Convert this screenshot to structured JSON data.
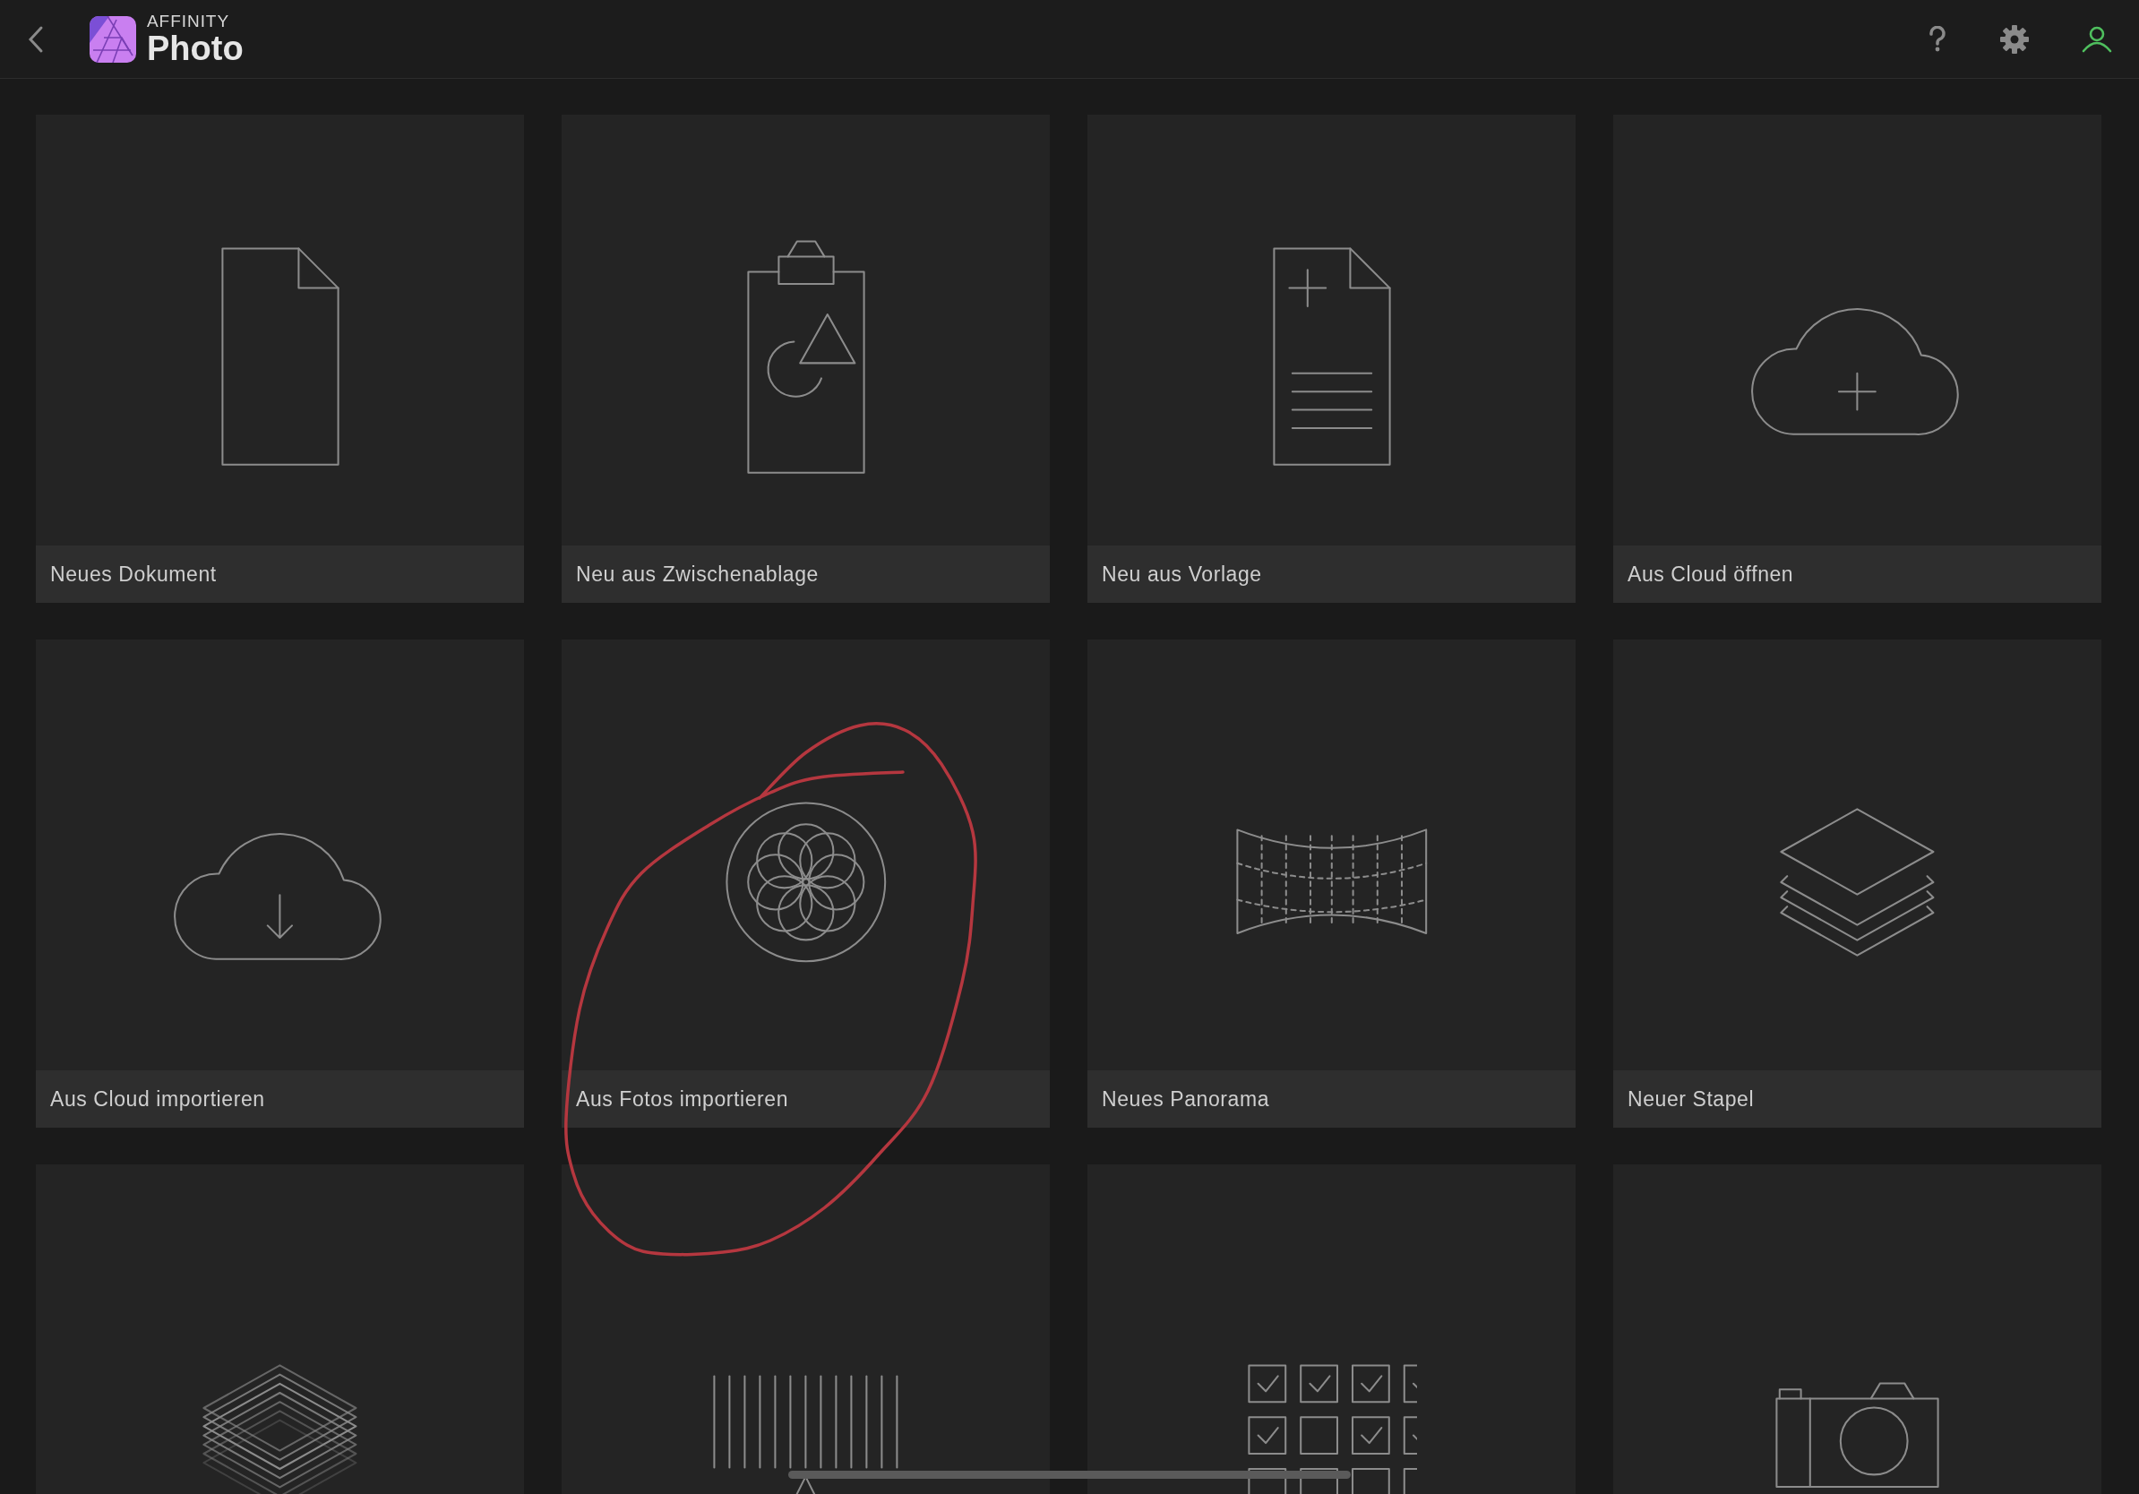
{
  "header": {
    "brand_small": "AFFINITY",
    "brand_name": "Photo"
  },
  "tiles": [
    {
      "kind": "document",
      "label": "Neues Dokument"
    },
    {
      "kind": "clipboard",
      "label": "Neu aus Zwischenablage"
    },
    {
      "kind": "template",
      "label": "Neu aus Vorlage"
    },
    {
      "kind": "cloud-open",
      "label": "Aus Cloud öffnen"
    },
    {
      "kind": "cloud-import",
      "label": "Aus Cloud importieren"
    },
    {
      "kind": "photos",
      "label": "Aus Fotos importieren"
    },
    {
      "kind": "panorama",
      "label": "Neues Panorama"
    },
    {
      "kind": "stack",
      "label": "Neuer Stapel"
    },
    {
      "kind": "hdr"
    },
    {
      "kind": "focus"
    },
    {
      "kind": "batch"
    },
    {
      "kind": "camera"
    }
  ]
}
